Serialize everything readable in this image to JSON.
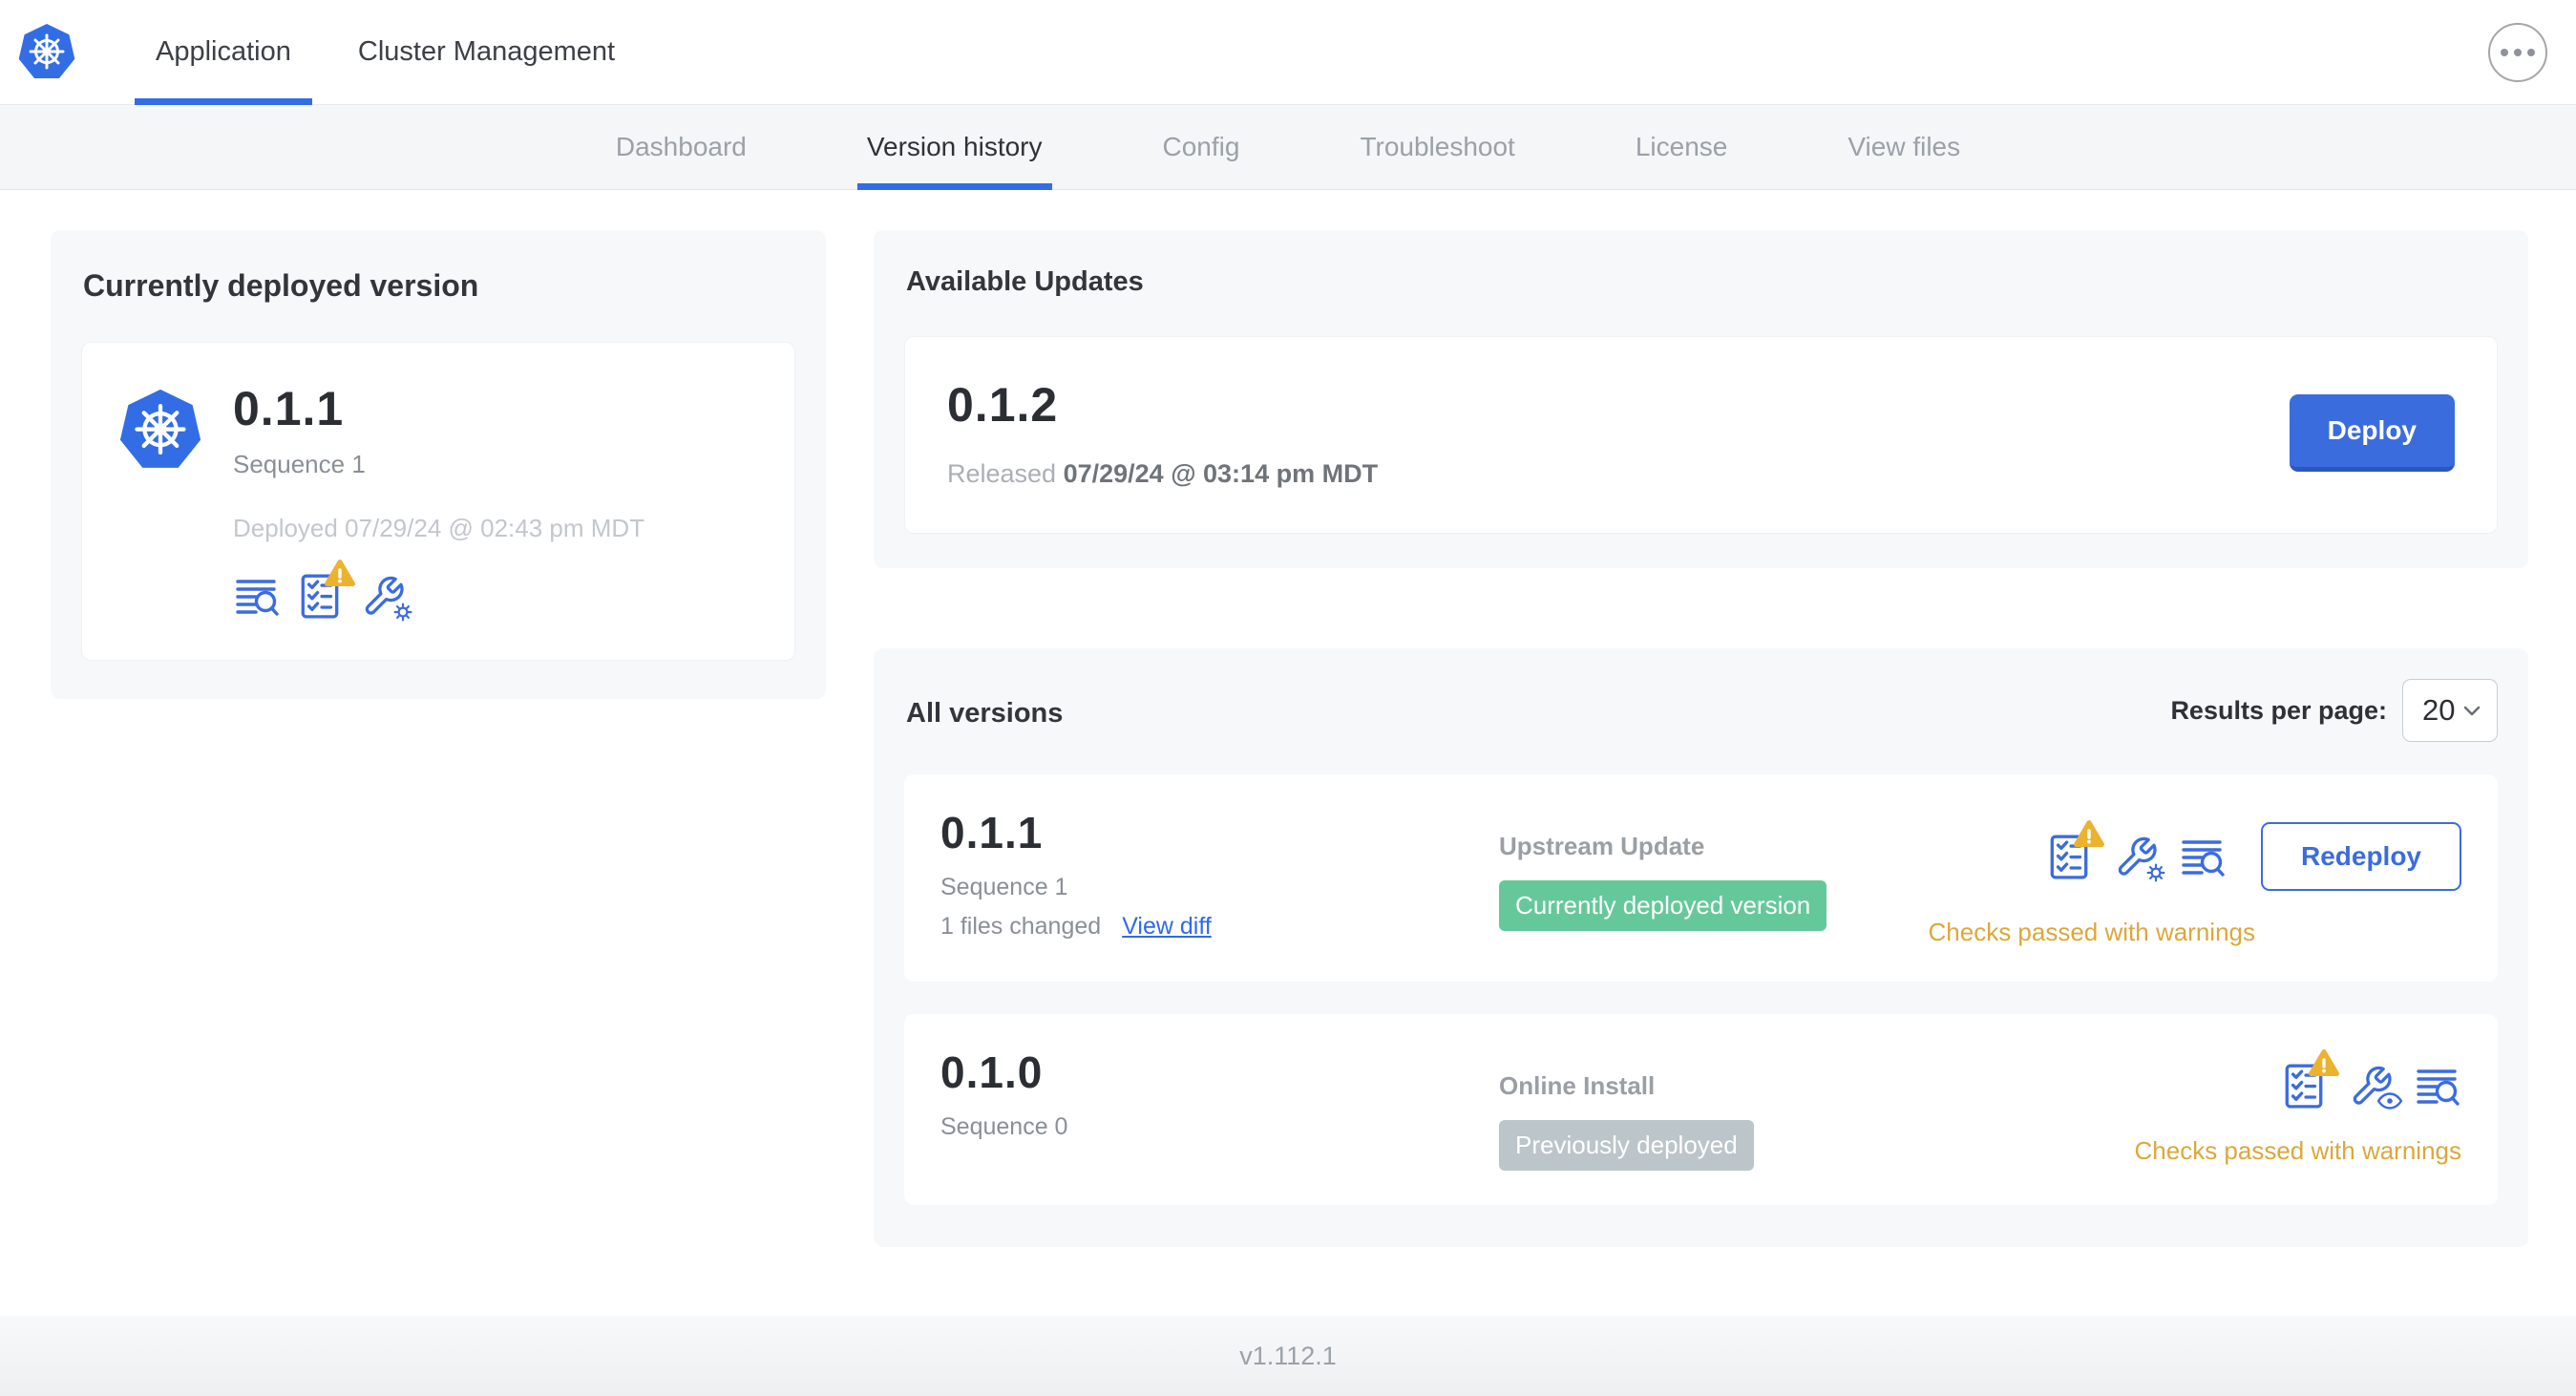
{
  "header": {
    "tabs": [
      {
        "label": "Application",
        "active": true
      },
      {
        "label": "Cluster Management",
        "active": false
      }
    ]
  },
  "subnav": {
    "tabs": [
      {
        "label": "Dashboard",
        "active": false
      },
      {
        "label": "Version history",
        "active": true
      },
      {
        "label": "Config",
        "active": false
      },
      {
        "label": "Troubleshoot",
        "active": false
      },
      {
        "label": "License",
        "active": false
      },
      {
        "label": "View files",
        "active": false
      }
    ]
  },
  "current_version_card": {
    "title": "Currently deployed version",
    "version": "0.1.1",
    "sequence": "Sequence 1",
    "deployed": "Deployed 07/29/24 @ 02:43 pm MDT",
    "icons": [
      "release-notes-icon",
      "preflight-checks-icon",
      "edit-config-icon"
    ]
  },
  "available_updates": {
    "title": "Available Updates",
    "version": "0.1.2",
    "released_prefix": "Released",
    "released_date": "07/29/24 @ 03:14 pm MDT",
    "deploy_label": "Deploy"
  },
  "all_versions": {
    "title": "All versions",
    "results_per_page_label": "Results per page:",
    "results_per_page_value": "20",
    "rows": [
      {
        "version": "0.1.1",
        "sequence": "Sequence 1",
        "files_changed": "1 files changed",
        "view_diff_label": "View diff",
        "source": "Upstream Update",
        "badge_label": "Currently deployed version",
        "badge_color": "#65c89b",
        "action_label": "Redeploy",
        "checks_text": "Checks passed with warnings",
        "icons": [
          "preflight-checks-icon",
          "edit-config-icon",
          "release-notes-icon"
        ]
      },
      {
        "version": "0.1.0",
        "sequence": "Sequence 0",
        "source": "Online Install",
        "badge_label": "Previously deployed",
        "badge_color": "#bcc5c9",
        "checks_text": "Checks passed with warnings",
        "icons": [
          "preflight-checks-icon",
          "view-config-icon",
          "release-notes-icon"
        ]
      }
    ]
  },
  "footer": {
    "version": "v1.112.1"
  },
  "icons": {
    "logo": "kubernetes-logo",
    "header_menu": "ellipsis-icon",
    "select_chevron": "chevron-down-icon",
    "warning_overlay": "warning-triangle-icon"
  },
  "colors": {
    "accent_blue": "#3b6cde",
    "logo_blue": "#326de6",
    "active_underline": "#326de6",
    "badge_green": "#65c89b",
    "badge_gray": "#bcc5c9",
    "warning_text": "#dda73a",
    "warning_triangle": "#ecb22e",
    "panel_bg": "#f6f8f9",
    "subnav_bg": "#f4f6f8"
  }
}
